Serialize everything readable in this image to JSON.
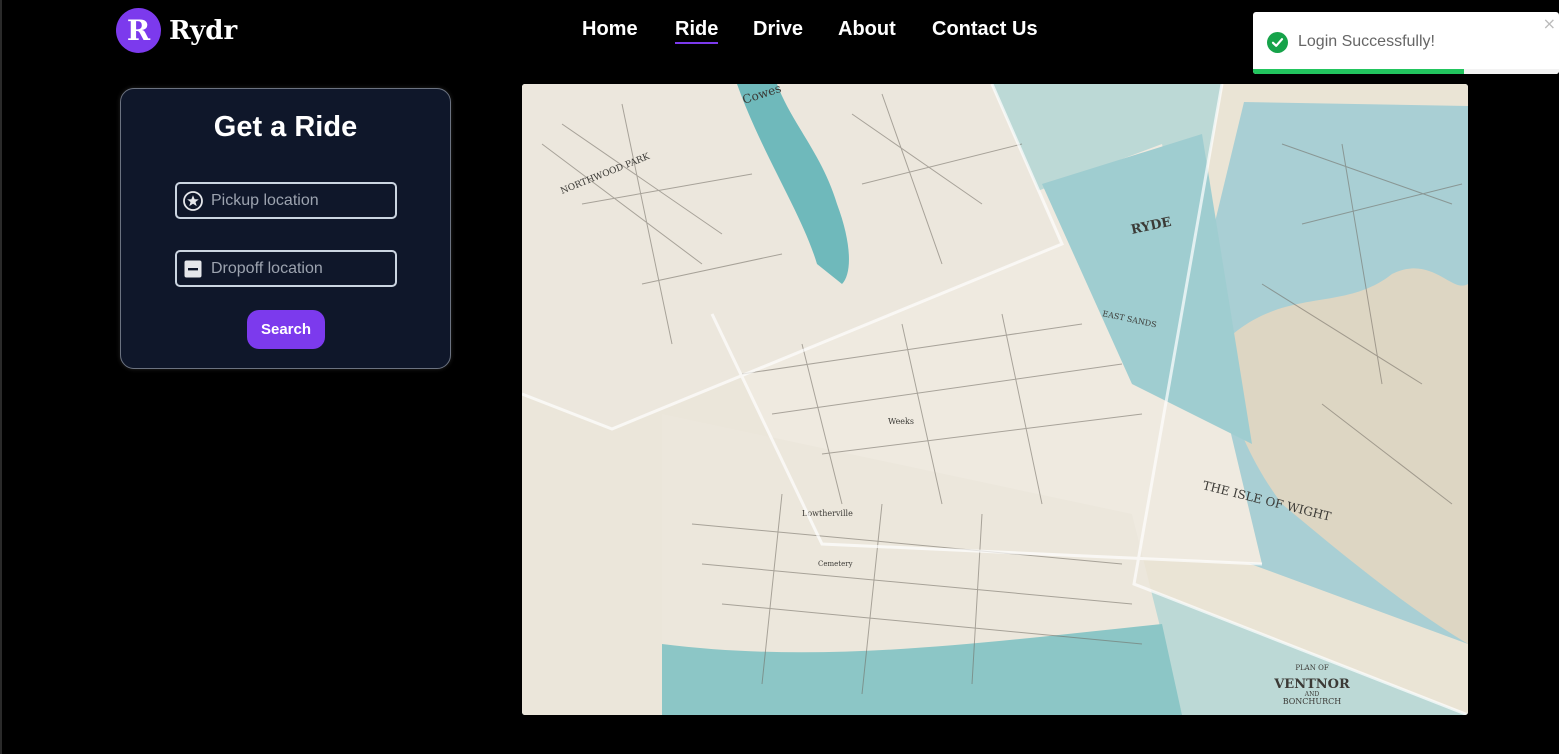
{
  "brand": {
    "logo_letter": "R",
    "name": "Rydr",
    "color": "#7c3aed"
  },
  "nav": {
    "items": [
      {
        "label": "Home",
        "active": false
      },
      {
        "label": "Ride",
        "active": true
      },
      {
        "label": "Drive",
        "active": false
      },
      {
        "label": "About",
        "active": false
      },
      {
        "label": "Contact Us",
        "active": false
      }
    ]
  },
  "toast": {
    "message": "Login Successfully!",
    "close_glyph": "×",
    "icon": "check-circle-icon",
    "progress": 0.69,
    "color": "#22c55e"
  },
  "ride_form": {
    "title": "Get a Ride",
    "pickup": {
      "placeholder": "Pickup location",
      "value": "",
      "icon": "star-circle-icon"
    },
    "dropoff": {
      "placeholder": "Dropoff location",
      "value": "",
      "icon": "minus-square-icon"
    },
    "search_label": "Search"
  },
  "hero_image": {
    "labels": {
      "northwood": "NORTHWOOD PARK",
      "cowes": "Cowes",
      "ryde": "RYDE",
      "east_sands": "EAST SANDS",
      "isle": "THE ISLE OF WIGHT",
      "plan_of": "PLAN OF",
      "ventnor": "VENTNOR",
      "and": "AND",
      "bonchurch": "BONCHURCH",
      "lowtherville": "Lowtherville",
      "cemetery": "Cemetery",
      "weeks": "Weeks"
    }
  }
}
